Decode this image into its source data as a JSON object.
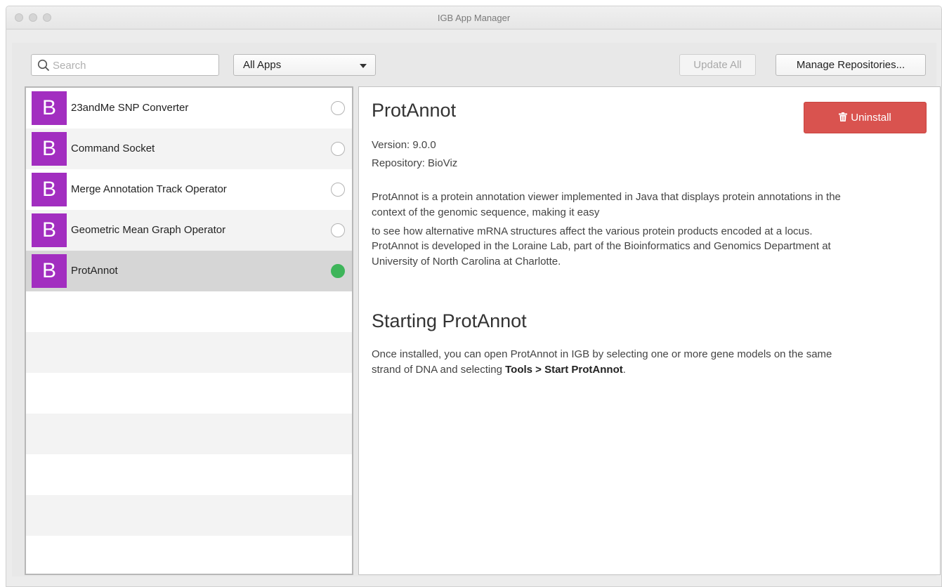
{
  "window": {
    "title": "IGB App Manager"
  },
  "toolbar": {
    "search_placeholder": "Search",
    "filter_selected": "All Apps",
    "update_all_label": "Update All",
    "manage_repos_label": "Manage Repositories..."
  },
  "apps": [
    {
      "icon_letter": "B",
      "name": "23andMe SNP Converter",
      "installed": false
    },
    {
      "icon_letter": "B",
      "name": "Command Socket",
      "installed": false
    },
    {
      "icon_letter": "B",
      "name": "Merge Annotation Track Operator",
      "installed": false
    },
    {
      "icon_letter": "B",
      "name": "Geometric Mean Graph Operator",
      "installed": false
    },
    {
      "icon_letter": "B",
      "name": "ProtAnnot",
      "installed": true
    }
  ],
  "detail": {
    "title": "ProtAnnot",
    "uninstall_label": "Uninstall",
    "version": "Version: 9.0.0",
    "repository": "Repository: BioViz",
    "description_line1": "ProtAnnot is a protein annotation viewer implemented in Java that displays protein annotations in the",
    "description_line2": "context of the genomic sequence, making it easy",
    "description_line3": "to see how alternative mRNA structures affect the various protein products encoded at a locus.",
    "developer_line1": "ProtAnnot is developed in the Loraine Lab, part of the Bioinformatics and Genomics Department at",
    "developer_line2": "University of North Carolina at Charlotte.",
    "section_heading": "Starting ProtAnnot",
    "usage_line1": "Once installed, you can open ProtAnnot in IGB by selecting one or more gene models on the same",
    "usage_line2_prefix": "strand of DNA and selecting ",
    "usage_line2_bold": "Tools > Start ProtAnnot",
    "usage_line2_suffix": "."
  },
  "colors": {
    "app_icon": "#a22ec0",
    "installed_status": "#3eb55a",
    "uninstall_button": "#d9534f",
    "selected_row": "#d6d6d6"
  }
}
